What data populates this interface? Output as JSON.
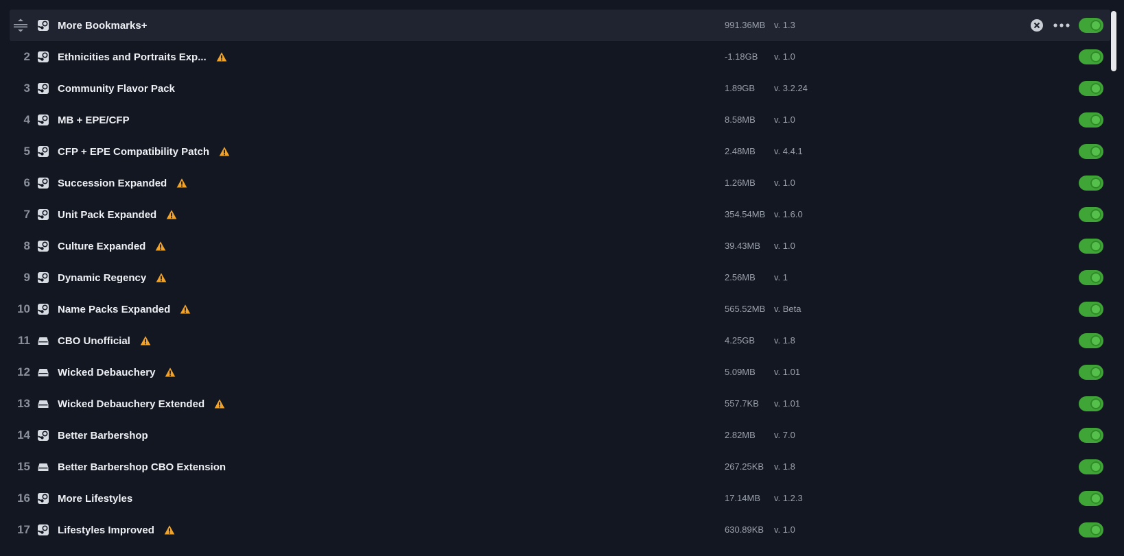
{
  "colors": {
    "background": "#131722",
    "active_row": "#1f2430",
    "toggle_on": "#3fa536",
    "warning": "#f0a22a",
    "text_primary": "#eef0f4",
    "text_secondary": "#9aa0ab"
  },
  "mods": [
    {
      "index": "",
      "name": "More Bookmarks+",
      "source": "steam",
      "warning": false,
      "size": "991.36MB",
      "version": "v. 1.3",
      "enabled": true
    },
    {
      "index": "2",
      "name": "Ethnicities and Portraits Exp...",
      "source": "steam",
      "warning": true,
      "size": "-1.18GB",
      "version": "v. 1.0",
      "enabled": true
    },
    {
      "index": "3",
      "name": "Community Flavor Pack",
      "source": "steam",
      "warning": false,
      "size": "1.89GB",
      "version": "v. 3.2.24",
      "enabled": true
    },
    {
      "index": "4",
      "name": "MB + EPE/CFP",
      "source": "steam",
      "warning": false,
      "size": "8.58MB",
      "version": "v. 1.0",
      "enabled": true
    },
    {
      "index": "5",
      "name": "CFP + EPE Compatibility Patch",
      "source": "steam",
      "warning": true,
      "size": "2.48MB",
      "version": "v. 4.4.1",
      "enabled": true
    },
    {
      "index": "6",
      "name": "Succession Expanded",
      "source": "steam",
      "warning": true,
      "size": "1.26MB",
      "version": "v. 1.0",
      "enabled": true
    },
    {
      "index": "7",
      "name": "Unit Pack Expanded",
      "source": "steam",
      "warning": true,
      "size": "354.54MB",
      "version": "v. 1.6.0",
      "enabled": true
    },
    {
      "index": "8",
      "name": "Culture Expanded",
      "source": "steam",
      "warning": true,
      "size": "39.43MB",
      "version": "v. 1.0",
      "enabled": true
    },
    {
      "index": "9",
      "name": "Dynamic Regency",
      "source": "steam",
      "warning": true,
      "size": "2.56MB",
      "version": "v. 1",
      "enabled": true
    },
    {
      "index": "10",
      "name": "Name Packs Expanded",
      "source": "steam",
      "warning": true,
      "size": "565.52MB",
      "version": "v. Beta",
      "enabled": true
    },
    {
      "index": "11",
      "name": "CBO Unofficial",
      "source": "local",
      "warning": true,
      "size": "4.25GB",
      "version": "v. 1.8",
      "enabled": true
    },
    {
      "index": "12",
      "name": "Wicked Debauchery",
      "source": "local",
      "warning": true,
      "size": "5.09MB",
      "version": "v. 1.01",
      "enabled": true
    },
    {
      "index": "13",
      "name": "Wicked Debauchery Extended",
      "source": "local",
      "warning": true,
      "size": "557.7KB",
      "version": "v. 1.01",
      "enabled": true
    },
    {
      "index": "14",
      "name": "Better Barbershop",
      "source": "steam",
      "warning": false,
      "size": "2.82MB",
      "version": "v. 7.0",
      "enabled": true
    },
    {
      "index": "15",
      "name": "Better Barbershop CBO Extension",
      "source": "local",
      "warning": false,
      "size": "267.25KB",
      "version": "v. 1.8",
      "enabled": true
    },
    {
      "index": "16",
      "name": "More Lifestyles",
      "source": "steam",
      "warning": false,
      "size": "17.14MB",
      "version": "v. 1.2.3",
      "enabled": true
    },
    {
      "index": "17",
      "name": "Lifestyles Improved",
      "source": "steam",
      "warning": true,
      "size": "630.89KB",
      "version": "v. 1.0",
      "enabled": true
    }
  ]
}
